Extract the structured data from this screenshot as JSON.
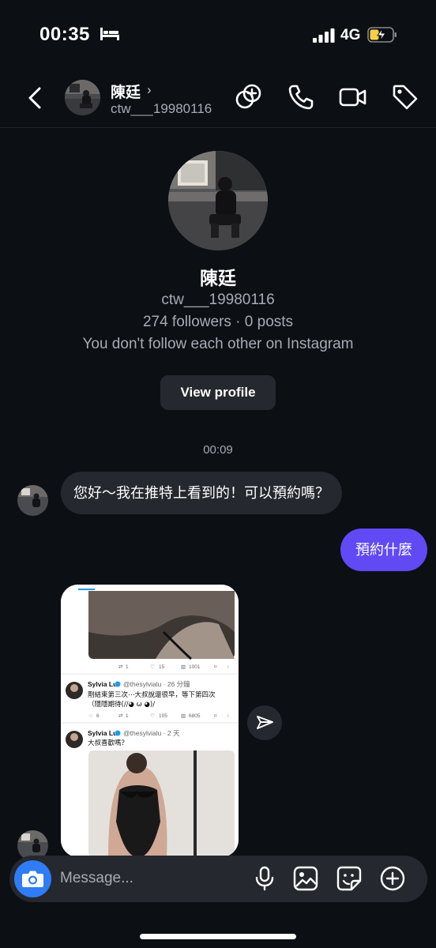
{
  "status_bar": {
    "time": "00:35",
    "network": "4G",
    "battery_icon": "charging-battery-icon"
  },
  "header": {
    "name": "陳廷",
    "chevron": "›",
    "username": "ctw___19980116"
  },
  "profile": {
    "name": "陳廷",
    "username": "ctw___19980116",
    "stats": "274 followers · 0 posts",
    "follow_status": "You don't follow each other on Instagram",
    "view_profile_label": "View profile"
  },
  "thread": {
    "timestamp": "00:09",
    "incoming_message": "您好～我在推特上看到的！可以預約嗎？",
    "outgoing_message": "預約什麼"
  },
  "shared_post": {
    "top_stats": {
      "replies": "",
      "retweets": "1",
      "likes": "15",
      "views": "1001"
    },
    "tweet1": {
      "name": "Sylvia Lu",
      "handle": "@thesylvialu · 26 分鐘",
      "text_line1": "剛結束第三次⋯大叔說還很早，等下第四次",
      "text_line2": "（隱隱期待(//◕ ω ◕)/",
      "stats": {
        "replies": "6",
        "retweets": "1",
        "likes": "105",
        "views": "6805"
      }
    },
    "tweet2": {
      "name": "Sylvia Lu",
      "handle": "@thesylvialu · 2 天",
      "text": "大叔喜歡嗎？"
    }
  },
  "composer": {
    "placeholder": "Message..."
  },
  "colors": {
    "background": "#0c0f14",
    "bubble_incoming": "#25282e",
    "bubble_outgoing": "#6149f4",
    "camera": "#2f7df6"
  }
}
